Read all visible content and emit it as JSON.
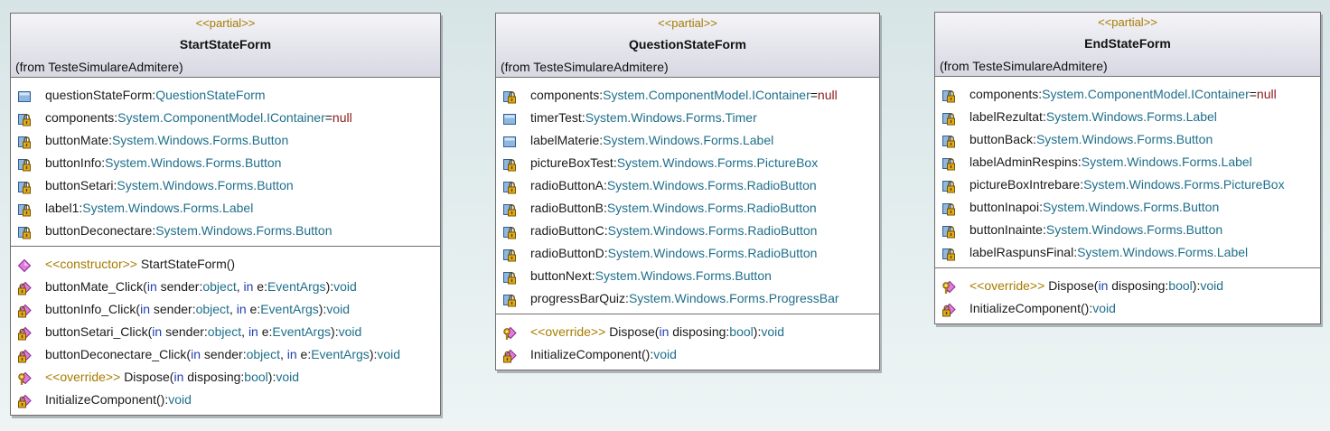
{
  "classes": [
    {
      "stereotype": "<<partial>>",
      "name": "StartStateForm",
      "from": "(from TesteSimulareAdmitere)",
      "attributes": [
        {
          "icon": "field-icon",
          "name": "questionStateForm",
          "sep": ":",
          "type": "QuestionStateForm"
        },
        {
          "icon": "private-field-icon",
          "name": "components",
          "sep": ":",
          "type": "System.ComponentModel.IContainer",
          "eq": "=",
          "default": "null"
        },
        {
          "icon": "private-field-icon",
          "name": "buttonMate",
          "sep": ":",
          "type": "System.Windows.Forms.Button"
        },
        {
          "icon": "private-field-icon",
          "name": "buttonInfo",
          "sep": ":",
          "type": "System.Windows.Forms.Button"
        },
        {
          "icon": "private-field-icon",
          "name": "buttonSetari",
          "sep": ":",
          "type": "System.Windows.Forms.Button"
        },
        {
          "icon": "private-field-icon",
          "name": "label1",
          "sep": ":",
          "type": "System.Windows.Forms.Label"
        },
        {
          "icon": "private-field-icon",
          "name": "buttonDeconectare",
          "sep": ":",
          "type": "System.Windows.Forms.Button"
        }
      ],
      "operations": [
        {
          "icon": "public-method-icon",
          "stereo": "<<constructor>>",
          "name": "StartStateForm()",
          "params": [],
          "ret": ""
        },
        {
          "icon": "private-method-icon",
          "name": "buttonMate_Click",
          "params": [
            {
              "dir": "in",
              "pname": "sender",
              "ptype": "object"
            },
            {
              "dir": "in",
              "pname": "e",
              "ptype": "EventArgs"
            }
          ],
          "ret": "void"
        },
        {
          "icon": "private-method-icon",
          "name": "buttonInfo_Click",
          "params": [
            {
              "dir": "in",
              "pname": "sender",
              "ptype": "object"
            },
            {
              "dir": "in",
              "pname": "e",
              "ptype": "EventArgs"
            }
          ],
          "ret": "void"
        },
        {
          "icon": "private-method-icon",
          "name": "buttonSetari_Click",
          "params": [
            {
              "dir": "in",
              "pname": "sender",
              "ptype": "object"
            },
            {
              "dir": "in",
              "pname": "e",
              "ptype": "EventArgs"
            }
          ],
          "ret": "void"
        },
        {
          "icon": "private-method-icon",
          "name": "buttonDeconectare_Click",
          "params": [
            {
              "dir": "in",
              "pname": "sender",
              "ptype": "object"
            },
            {
              "dir": "in",
              "pname": "e",
              "ptype": "EventArgs"
            }
          ],
          "ret": "void"
        },
        {
          "icon": "protected-method-icon",
          "stereo": "<<override>>",
          "name": "Dispose",
          "params": [
            {
              "dir": "in",
              "pname": "disposing",
              "ptype": "bool"
            }
          ],
          "ret": "void"
        },
        {
          "icon": "private-method-icon",
          "name": "InitializeComponent",
          "params": [],
          "ret": "void"
        }
      ]
    },
    {
      "stereotype": "<<partial>>",
      "name": "QuestionStateForm",
      "from": "(from TesteSimulareAdmitere)",
      "attributes": [
        {
          "icon": "private-field-icon",
          "name": "components",
          "sep": ":",
          "type": "System.ComponentModel.IContainer",
          "eq": "=",
          "default": "null"
        },
        {
          "icon": "field-icon",
          "name": "timerTest",
          "sep": ":",
          "type": "System.Windows.Forms.Timer"
        },
        {
          "icon": "field-icon",
          "name": "labelMaterie",
          "sep": ":",
          "type": "System.Windows.Forms.Label"
        },
        {
          "icon": "private-field-icon",
          "name": "pictureBoxTest",
          "sep": ":",
          "type": "System.Windows.Forms.PictureBox"
        },
        {
          "icon": "private-field-icon",
          "name": "radioButtonA",
          "sep": ":",
          "type": "System.Windows.Forms.RadioButton"
        },
        {
          "icon": "private-field-icon",
          "name": "radioButtonB",
          "sep": ":",
          "type": "System.Windows.Forms.RadioButton"
        },
        {
          "icon": "private-field-icon",
          "name": "radioButtonC",
          "sep": ":",
          "type": "System.Windows.Forms.RadioButton"
        },
        {
          "icon": "private-field-icon",
          "name": "radioButtonD",
          "sep": ":",
          "type": "System.Windows.Forms.RadioButton"
        },
        {
          "icon": "private-field-icon",
          "name": "buttonNext",
          "sep": ":",
          "type": "System.Windows.Forms.Button"
        },
        {
          "icon": "private-field-icon",
          "name": "progressBarQuiz",
          "sep": ":",
          "type": "System.Windows.Forms.ProgressBar"
        }
      ],
      "operations": [
        {
          "icon": "protected-method-icon",
          "stereo": "<<override>>",
          "name": "Dispose",
          "params": [
            {
              "dir": "in",
              "pname": "disposing",
              "ptype": "bool"
            }
          ],
          "ret": "void"
        },
        {
          "icon": "private-method-icon",
          "name": "InitializeComponent",
          "params": [],
          "ret": "void"
        }
      ]
    },
    {
      "stereotype": "<<partial>>",
      "name": "EndStateForm",
      "from": "(from TesteSimulareAdmitere)",
      "attributes": [
        {
          "icon": "private-field-icon",
          "name": "components",
          "sep": ":",
          "type": "System.ComponentModel.IContainer",
          "eq": "=",
          "default": "null"
        },
        {
          "icon": "private-field-icon",
          "name": "labelRezultat",
          "sep": ":",
          "type": "System.Windows.Forms.Label"
        },
        {
          "icon": "private-field-icon",
          "name": "buttonBack",
          "sep": ":",
          "type": "System.Windows.Forms.Button"
        },
        {
          "icon": "private-field-icon",
          "name": "labelAdminRespins",
          "sep": ":",
          "type": "System.Windows.Forms.Label"
        },
        {
          "icon": "private-field-icon",
          "name": "pictureBoxIntrebare",
          "sep": ":",
          "type": "System.Windows.Forms.PictureBox"
        },
        {
          "icon": "private-field-icon",
          "name": "buttonInapoi",
          "sep": ":",
          "type": "System.Windows.Forms.Button"
        },
        {
          "icon": "private-field-icon",
          "name": "buttonInainte",
          "sep": ":",
          "type": "System.Windows.Forms.Button"
        },
        {
          "icon": "private-field-icon",
          "name": "labelRaspunsFinal",
          "sep": ":",
          "type": "System.Windows.Forms.Label"
        }
      ],
      "operations": [
        {
          "icon": "protected-method-icon",
          "stereo": "<<override>>",
          "name": "Dispose",
          "params": [
            {
              "dir": "in",
              "pname": "disposing",
              "ptype": "bool"
            }
          ],
          "ret": "void"
        },
        {
          "icon": "private-method-icon",
          "name": "InitializeComponent",
          "params": [],
          "ret": "void"
        }
      ]
    }
  ]
}
